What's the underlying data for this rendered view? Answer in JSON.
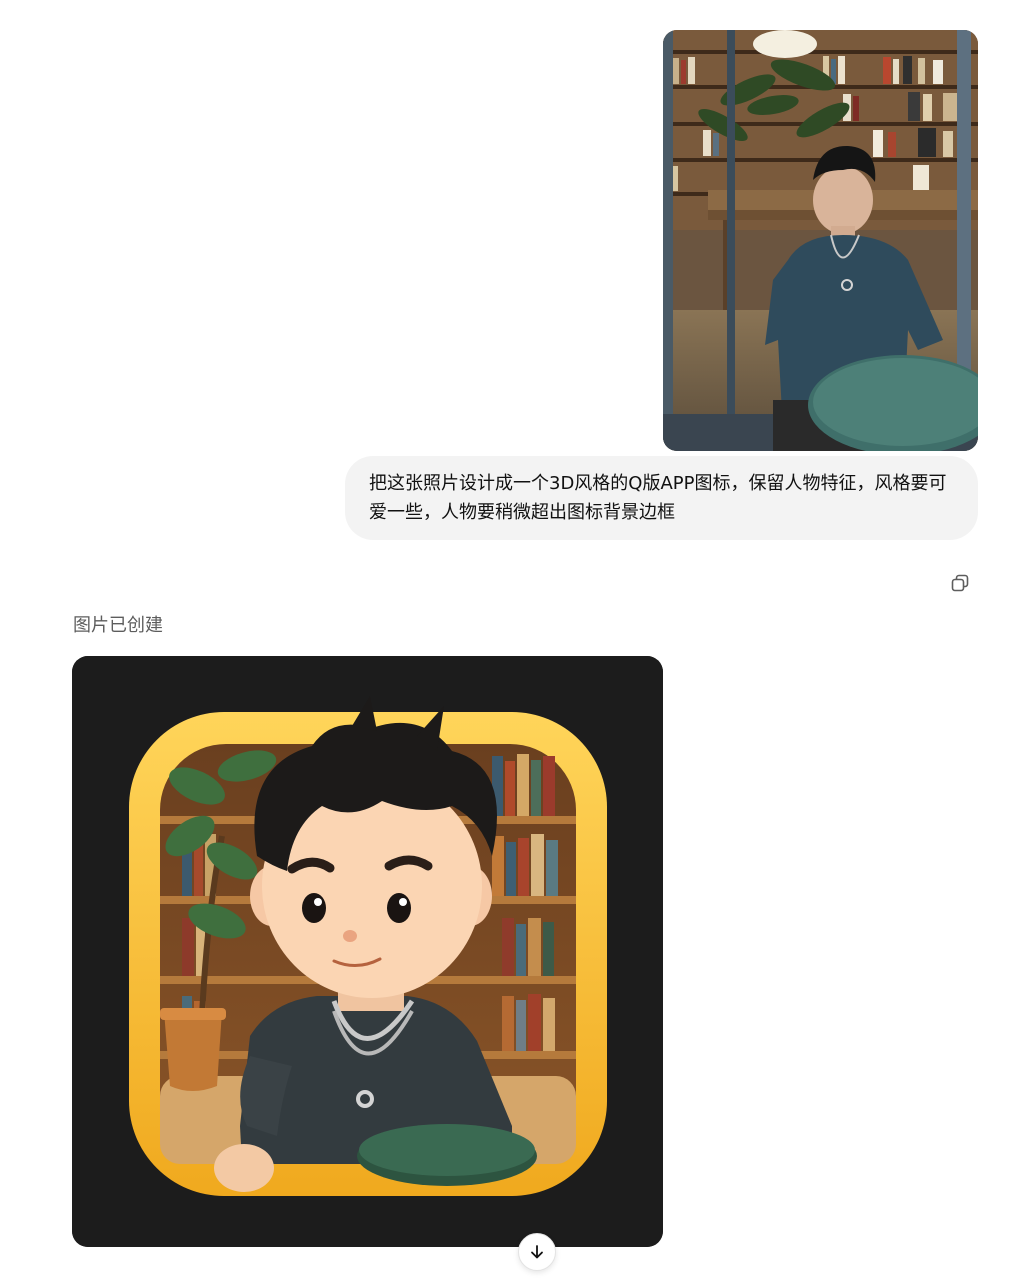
{
  "conversation": {
    "user_message": {
      "attachment_icon": "photo-thumbnail",
      "text": "把这张照片设计成一个3D风格的Q版APP图标，保留人物特征，风格要可爱一些，人物要稍微超出图标背景边框"
    },
    "actions": {
      "copy_icon": "copy-icon"
    },
    "assistant_message": {
      "status": "图片已创建",
      "image_icon": "generated-app-icon"
    },
    "scroll_icon": "arrow-down-icon"
  },
  "colors": {
    "bubble_bg": "#f3f3f3",
    "status_text": "#5d5d5d",
    "icon_frame": "#f5b731",
    "image_bg": "#1c1c1c"
  }
}
